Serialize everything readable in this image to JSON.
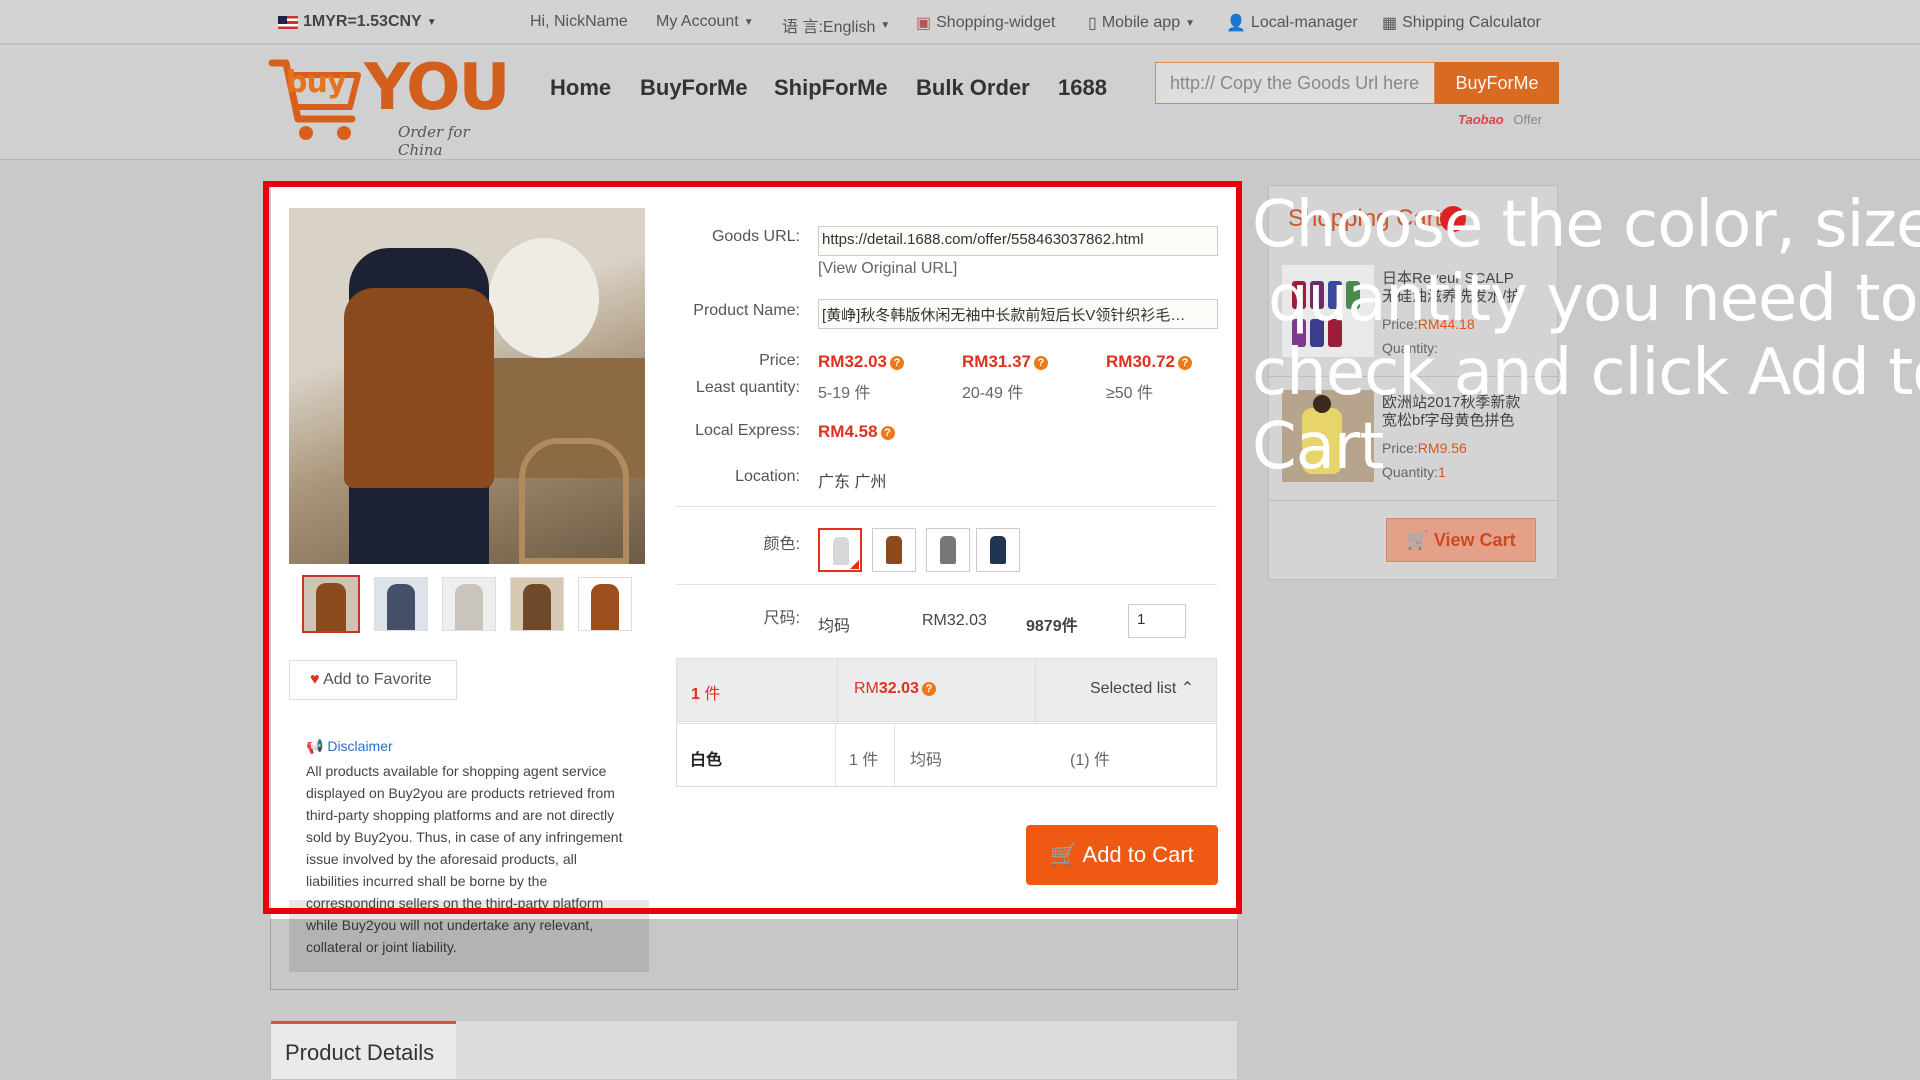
{
  "topbar": {
    "rate": "1MYR=1.53CNY",
    "greeting": "Hi, NickName",
    "account": "My Account",
    "language": "语 言:English",
    "widget": "Shopping-widget",
    "mobile": "Mobile app",
    "local_manager": "Local-manager",
    "shipping_calc": "Shipping Calculator"
  },
  "header": {
    "logo_buy": "buy",
    "logo_you": "YOU",
    "logo_tagline": "Order for China",
    "nav": [
      "Home",
      "BuyForMe",
      "ShipForMe",
      "Bulk Order",
      "1688"
    ],
    "search_placeholder": "http:// Copy the Goods Url here",
    "search_button": "BuyForMe",
    "offer_label": "Offer",
    "taobao": "Taobao"
  },
  "product": {
    "goods_url_label": "Goods URL:",
    "goods_url": "https://detail.1688.com/offer/558463037862.html",
    "view_original": "[View Original URL]",
    "name_label": "Product Name:",
    "name": "[黄峥]秋冬韩版休闲无袖中长款前短后长V领针织衫毛…",
    "price_label": "Price:",
    "least_qty_label": "Least quantity:",
    "tiers": [
      {
        "price": "RM32.03",
        "qty": "5-19 件"
      },
      {
        "price": "RM31.37",
        "qty": "20-49 件"
      },
      {
        "price": "RM30.72",
        "qty": "≥50 件"
      }
    ],
    "express_label": "Local Express:",
    "express": "RM4.58",
    "location_label": "Location:",
    "location": "广东 广州",
    "color_label": "颜色:",
    "size_label": "尺码:",
    "size_value": "均码",
    "size_price": "RM32.03",
    "size_stock": "9879件",
    "qty_value": "1",
    "add_favorite": "Add to Favorite",
    "disclaimer_title": "Disclaimer",
    "disclaimer_text": "All products available for shopping agent service displayed on Buy2you are products retrieved from third-party shopping platforms and are not directly sold by Buy2you. Thus, in case of any infringement issue involved by the aforesaid products, all liabilities incurred shall be borne by the corresponding sellers on the third-party platform while Buy2you will not undertake any relevant, collateral or joint liability.",
    "add_to_cart": "Add to Cart"
  },
  "summary": {
    "count": "1",
    "count_unit": "件",
    "total_prefix": "RM",
    "total": "32.03",
    "selected_list": "Selected list"
  },
  "selected_row": {
    "color": "白色",
    "qty": "1 件",
    "size": "均码",
    "count": "(1) 件"
  },
  "tabs": {
    "product_details": "Product Details"
  },
  "cart": {
    "title": "Shopping Cart",
    "items": [
      {
        "name": "日本Reveur SCALP 无硅油滋养洗发水/护",
        "price_label": "Price:",
        "price": "RM44.18",
        "qty_label": "Quantity:",
        "qty": ""
      },
      {
        "name": "欧洲站2017秋季新款 宽松bf字母黄色拼色",
        "price_label": "Price:",
        "price": "RM9.56",
        "qty_label": "Quantity:",
        "qty": "1"
      }
    ],
    "view_cart": "View Cart"
  },
  "instruction": {
    "lines": [
      "Choose the color, size,",
      "quantity you need to",
      "check and click Add to",
      "Cart"
    ]
  },
  "colors": {
    "accent": "#ee5a14",
    "highlight": "#e8000d",
    "price": "#e0301e"
  }
}
